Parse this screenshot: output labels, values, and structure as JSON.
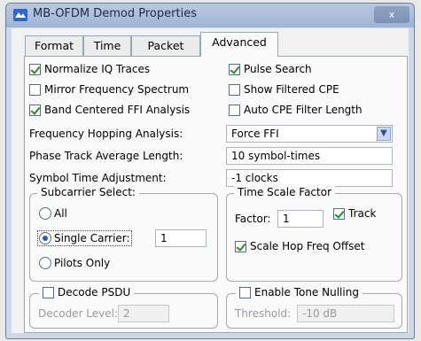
{
  "window": {
    "title": "MB-OFDM Demod Properties",
    "close_label": "x"
  },
  "tabs": [
    {
      "label": "Format",
      "active": false
    },
    {
      "label": "Time",
      "active": false
    },
    {
      "label": "Packet",
      "active": false
    },
    {
      "label": "Advanced",
      "active": true
    }
  ],
  "options": {
    "normalize_iq": {
      "label": "Normalize IQ Traces",
      "checked": true
    },
    "mirror_freq": {
      "label": "Mirror Frequency Spectrum",
      "checked": false
    },
    "band_centered": {
      "label": "Band Centered FFI Analysis",
      "checked": true
    },
    "pulse_search": {
      "label": "Pulse Search",
      "checked": true
    },
    "show_filtered_cpe": {
      "label": "Show Filtered CPE",
      "checked": false
    },
    "auto_cpe": {
      "label": "Auto CPE Filter Length",
      "checked": false
    }
  },
  "freq_hopping": {
    "label": "Frequency Hopping Analysis:",
    "value": "Force FFI"
  },
  "phase_track": {
    "label": "Phase Track Average Length:",
    "value": "10 symbol-times"
  },
  "symbol_time": {
    "label": "Symbol Time Adjustment:",
    "value": "-1 clocks"
  },
  "subcarrier": {
    "legend": "Subcarrier Select:",
    "all_label": "All",
    "single_label": "Single Carrier:",
    "single_value": "1",
    "pilots_label": "Pilots Only",
    "selected": "single"
  },
  "time_scale": {
    "legend": "Time Scale Factor",
    "factor_label": "Factor:",
    "factor_value": "1",
    "track_label": "Track",
    "track_checked": true,
    "scale_hop_label": "Scale Hop Freq Offset",
    "scale_hop_checked": true
  },
  "decode_psdu": {
    "legend": "Decode PSDU",
    "checked": false,
    "level_label": "Decoder Level:",
    "level_value": "2"
  },
  "tone_nulling": {
    "legend": "Enable Tone Nulling",
    "checked": false,
    "threshold_label": "Threshold:",
    "threshold_value": "-10 dB"
  }
}
